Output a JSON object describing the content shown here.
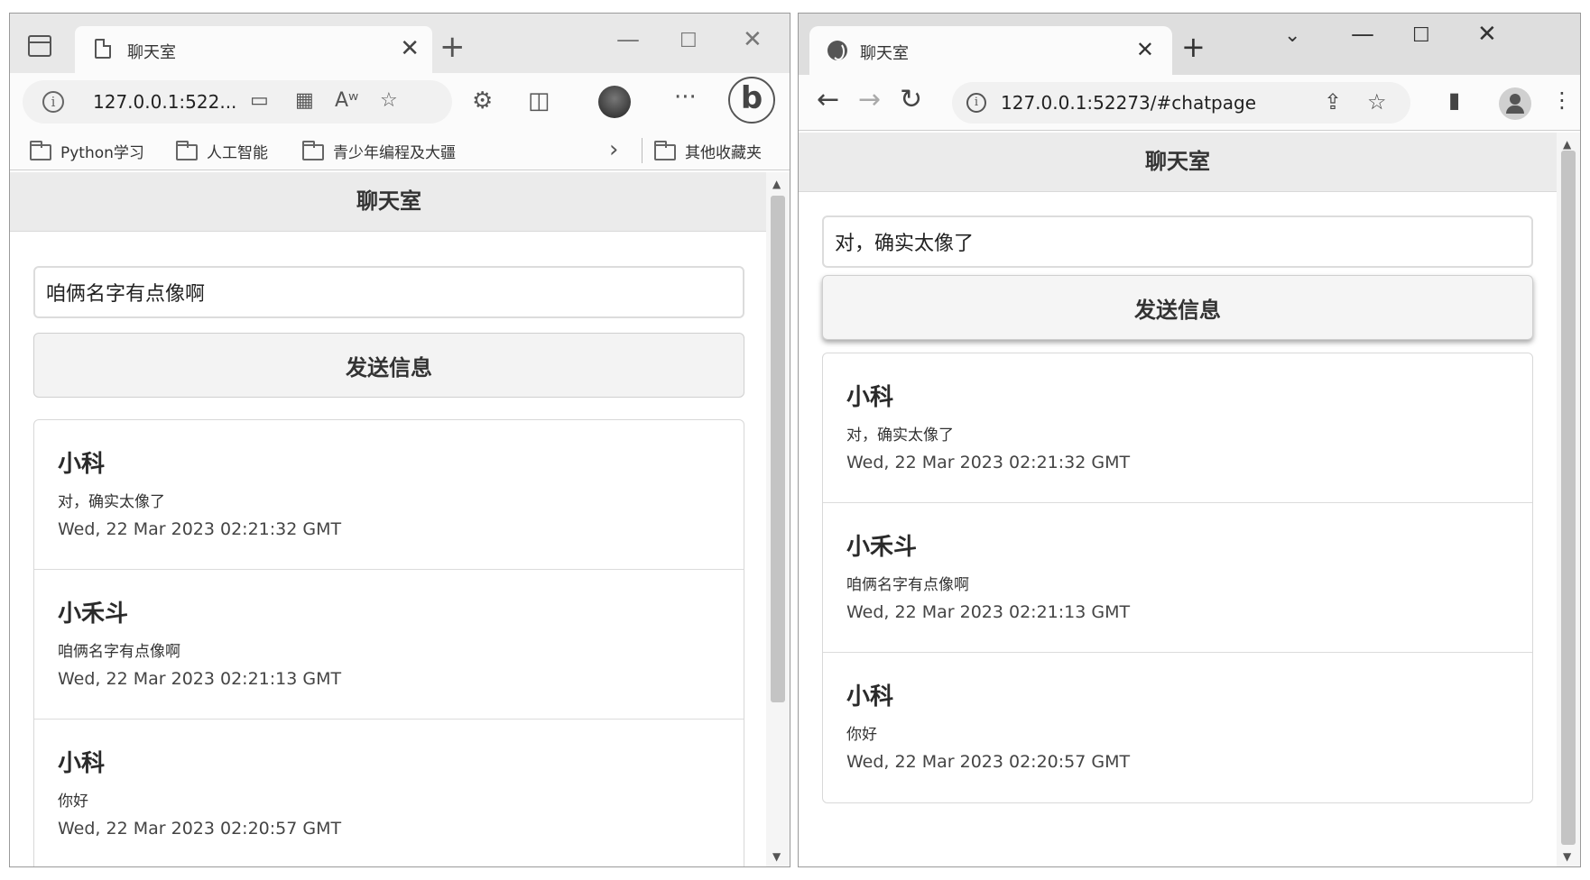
{
  "left_window": {
    "browser": "edge",
    "tab": {
      "title": "聊天室"
    },
    "address": {
      "url": "127.0.0.1:522..."
    },
    "bookmarks": [
      "Python学习",
      "人工智能",
      "青少年编程及大疆"
    ],
    "other_bookmarks": "其他收藏夹",
    "page": {
      "header": "聊天室",
      "input_value": "咱俩名字有点像啊",
      "send_label": "发送信息",
      "messages": [
        {
          "name": "小科",
          "text": "对，确实太像了",
          "time": "Wed, 22 Mar 2023 02:21:32 GMT"
        },
        {
          "name": "小禾斗",
          "text": "咱俩名字有点像啊",
          "time": "Wed, 22 Mar 2023 02:21:13 GMT"
        },
        {
          "name": "小科",
          "text": "你好",
          "time": "Wed, 22 Mar 2023 02:20:57 GMT"
        }
      ]
    }
  },
  "right_window": {
    "browser": "chrome",
    "tab": {
      "title": "聊天室"
    },
    "address": {
      "url": "127.0.0.1:52273/#chatpage"
    },
    "page": {
      "header": "聊天室",
      "input_value": "对，确实太像了",
      "send_label": "发送信息",
      "messages": [
        {
          "name": "小科",
          "text": "对，确实太像了",
          "time": "Wed, 22 Mar 2023 02:21:32 GMT"
        },
        {
          "name": "小禾斗",
          "text": "咱俩名字有点像啊",
          "time": "Wed, 22 Mar 2023 02:21:13 GMT"
        },
        {
          "name": "小科",
          "text": "你好",
          "time": "Wed, 22 Mar 2023 02:20:57 GMT"
        }
      ]
    }
  },
  "icons": {
    "tab_close": "✕",
    "new_tab": "+",
    "minimize": "—",
    "maximize": "☐",
    "close": "✕",
    "more": "···",
    "back": "←",
    "forward": "→",
    "reload": "↻",
    "star": "☆",
    "chevron": "›",
    "kebab": "⋮",
    "dropdown": "⌄"
  }
}
